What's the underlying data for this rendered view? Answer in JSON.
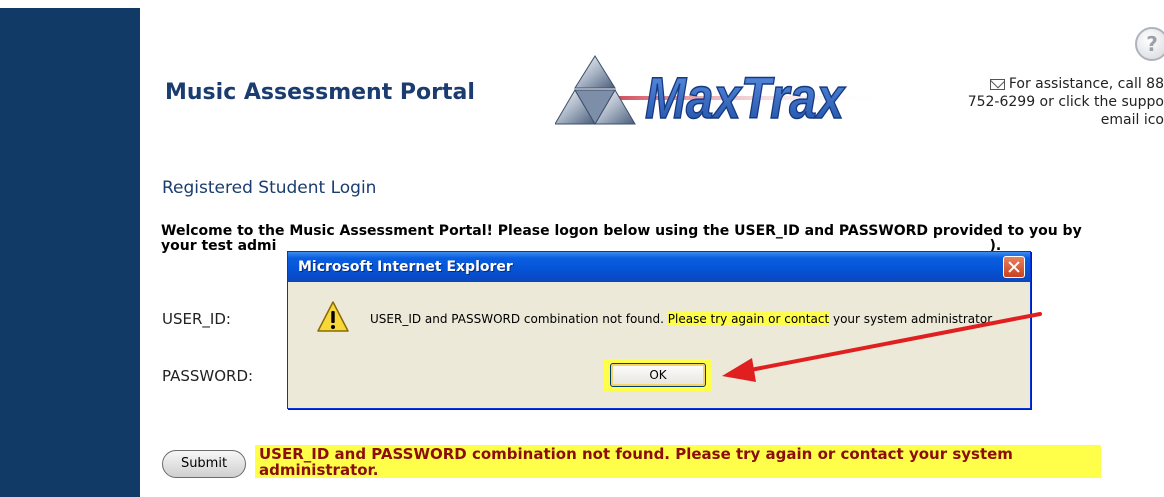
{
  "header": {
    "portal_title": "Music Assessment Portal",
    "logo_text": "MaxTrax",
    "help_icon_glyph": "?",
    "assist_line1": "For assistance, call 88",
    "assist_line2": "752-6299 or click the suppo",
    "assist_line3": "email ico"
  },
  "login": {
    "heading": "Registered Student Login",
    "welcome_line1": "Welcome to the Music Assessment Portal! Please logon below using the USER_ID and PASSWORD provided to you by",
    "welcome_line2": "your test admi",
    "welcome_tail": ").",
    "user_id_label": "USER_ID:",
    "password_label": "PASSWORD:",
    "submit_label": "Submit",
    "error_message": "USER_ID and PASSWORD combination not found. Please try again or contact your system administrator."
  },
  "dialog": {
    "title": "Microsoft Internet Explorer",
    "message_part1": "USER_ID and PASSWORD combination not found.",
    "message_highlight": "Please try again or contact",
    "message_part2": "your system administrator",
    "ok_label": "OK"
  },
  "colors": {
    "left_bar": "#123a66",
    "title_text": "#1a3c6e",
    "highlight": "#ffff4a",
    "error_text": "#8b0d0d",
    "arrow": "#e02020"
  }
}
